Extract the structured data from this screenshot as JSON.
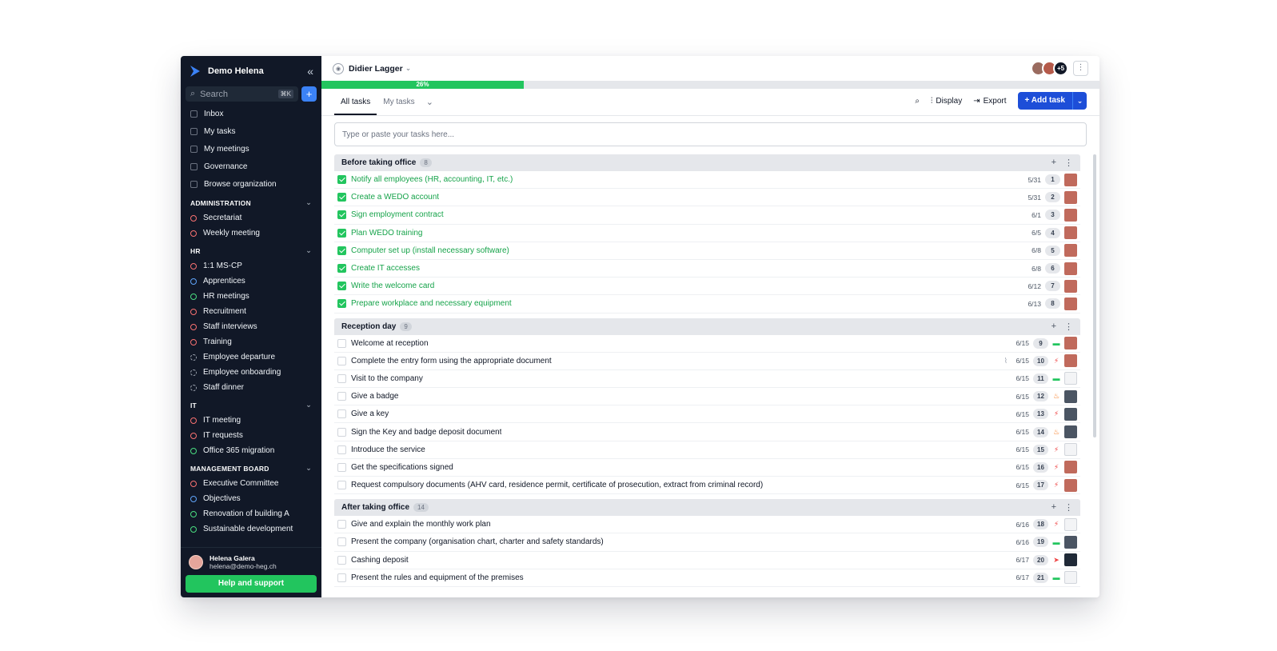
{
  "sidebar": {
    "org_name": "Demo Helena",
    "search_placeholder": "Search",
    "search_shortcut": "⌘K",
    "nav": [
      {
        "label": "Inbox"
      },
      {
        "label": "My tasks"
      },
      {
        "label": "My meetings"
      },
      {
        "label": "Governance"
      },
      {
        "label": "Browse organization"
      }
    ],
    "sections": [
      {
        "title": "ADMINISTRATION",
        "items": [
          {
            "label": "Secretariat",
            "color": "red"
          },
          {
            "label": "Weekly meeting",
            "color": "red"
          }
        ]
      },
      {
        "title": "HR",
        "items": [
          {
            "label": "1:1 MS-CP",
            "color": "red"
          },
          {
            "label": "Apprentices",
            "color": "blue"
          },
          {
            "label": "HR meetings",
            "color": "green"
          },
          {
            "label": "Recruitment",
            "color": "red"
          },
          {
            "label": "Staff interviews",
            "color": "red"
          },
          {
            "label": "Training",
            "color": "red"
          },
          {
            "label": "Employee departure",
            "color": "dash"
          },
          {
            "label": "Employee onboarding",
            "color": "dash"
          },
          {
            "label": "Staff dinner",
            "color": "dash"
          }
        ]
      },
      {
        "title": "IT",
        "items": [
          {
            "label": "IT meeting",
            "color": "red"
          },
          {
            "label": "IT requests",
            "color": "red"
          },
          {
            "label": "Office 365 migration",
            "color": "green"
          }
        ]
      },
      {
        "title": "MANAGEMENT BOARD",
        "items": [
          {
            "label": "Executive Committee",
            "color": "red"
          },
          {
            "label": "Objectives",
            "color": "blue"
          },
          {
            "label": "Renovation of building A",
            "color": "green"
          },
          {
            "label": "Sustainable development",
            "color": "green"
          }
        ]
      }
    ],
    "user": {
      "name": "Helena Galera",
      "email": "helena@demo-heg.ch"
    },
    "help_label": "Help and support"
  },
  "header": {
    "owner": "Didier Lagger",
    "avatars_more": "+5",
    "progress": {
      "label": "26%",
      "value": 26
    }
  },
  "toolbar": {
    "tabs": [
      {
        "label": "All tasks",
        "active": true
      },
      {
        "label": "My tasks",
        "active": false
      }
    ],
    "display_label": "Display",
    "export_label": "Export",
    "add_task_label": "Add task",
    "quick_add_placeholder": "Type or paste your tasks here..."
  },
  "groups": [
    {
      "title": "Before taking office",
      "count": "8",
      "tasks": [
        {
          "title": "Notify all employees (HR, accounting, IT, etc.)",
          "done": true,
          "date": "5/31",
          "num": "1",
          "prio": "",
          "avatar": "red"
        },
        {
          "title": "Create a WEDO account",
          "done": true,
          "date": "5/31",
          "num": "2",
          "prio": "",
          "avatar": "red"
        },
        {
          "title": "Sign employment contract",
          "done": true,
          "date": "6/1",
          "num": "3",
          "prio": "",
          "avatar": "red"
        },
        {
          "title": "Plan WEDO training",
          "done": true,
          "date": "6/5",
          "num": "4",
          "prio": "",
          "avatar": "red"
        },
        {
          "title": "Computer set up (install necessary software)",
          "done": true,
          "date": "6/8",
          "num": "5",
          "prio": "",
          "avatar": "red"
        },
        {
          "title": "Create IT accesses",
          "done": true,
          "date": "6/8",
          "num": "6",
          "prio": "",
          "avatar": "red"
        },
        {
          "title": "Write the welcome card",
          "done": true,
          "date": "6/12",
          "num": "7",
          "prio": "",
          "avatar": "red"
        },
        {
          "title": "Prepare workplace and necessary equipment",
          "done": true,
          "date": "6/13",
          "num": "8",
          "prio": "",
          "avatar": "red"
        }
      ]
    },
    {
      "title": "Reception day",
      "count": "9",
      "tasks": [
        {
          "title": "Welcome at reception",
          "done": false,
          "date": "6/15",
          "num": "9",
          "prio": "low",
          "avatar": "red"
        },
        {
          "title": "Complete the entry form using the appropriate document",
          "done": false,
          "date": "6/15",
          "num": "10",
          "prio": "high",
          "avatar": "red",
          "clip": true
        },
        {
          "title": "Visit to the company",
          "done": false,
          "date": "6/15",
          "num": "11",
          "prio": "low",
          "avatar": "empty"
        },
        {
          "title": "Give a badge",
          "done": false,
          "date": "6/15",
          "num": "12",
          "prio": "fire",
          "avatar": "bw"
        },
        {
          "title": "Give a key",
          "done": false,
          "date": "6/15",
          "num": "13",
          "prio": "high",
          "avatar": "bw"
        },
        {
          "title": "Sign the Key and badge deposit document",
          "done": false,
          "date": "6/15",
          "num": "14",
          "prio": "fire",
          "avatar": "bw"
        },
        {
          "title": "Introduce the service",
          "done": false,
          "date": "6/15",
          "num": "15",
          "prio": "high",
          "avatar": "empty"
        },
        {
          "title": "Get the specifications signed",
          "done": false,
          "date": "6/15",
          "num": "16",
          "prio": "high",
          "avatar": "red"
        },
        {
          "title": "Request compulsory documents (AHV card, residence permit, certificate of prosecution, extract from criminal record)",
          "done": false,
          "date": "6/15",
          "num": "17",
          "prio": "high",
          "avatar": "red"
        }
      ]
    },
    {
      "title": "After taking office",
      "count": "14",
      "tasks": [
        {
          "title": "Give and explain the monthly work plan",
          "done": false,
          "date": "6/16",
          "num": "18",
          "prio": "high",
          "avatar": "empty"
        },
        {
          "title": "Present the company (organisation chart, charter and safety standards)",
          "done": false,
          "date": "6/16",
          "num": "19",
          "prio": "low",
          "avatar": "bw"
        },
        {
          "title": "Cashing deposit",
          "done": false,
          "date": "6/17",
          "num": "20",
          "prio": "send",
          "avatar": "dark"
        },
        {
          "title": "Present the rules and equipment of the premises",
          "done": false,
          "date": "6/17",
          "num": "21",
          "prio": "low",
          "avatar": "empty"
        }
      ]
    }
  ],
  "colors": {
    "accent": "#1d4ed8",
    "success": "#22c55e",
    "sidebar": "#111827"
  }
}
